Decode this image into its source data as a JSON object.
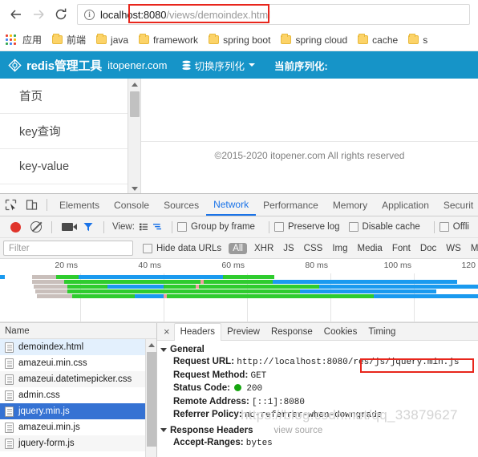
{
  "browser": {
    "back_icon": "arrow-left-icon",
    "forward_icon": "arrow-right-icon",
    "reload_icon": "reload-icon",
    "info_glyph": "i",
    "url_host": "localhost:8080",
    "url_path": "/views/demoindex.html",
    "apps_label": "应用",
    "bookmarks": [
      {
        "label": "前端"
      },
      {
        "label": "java"
      },
      {
        "label": "framework"
      },
      {
        "label": "spring boot"
      },
      {
        "label": "spring cloud"
      },
      {
        "label": "cache"
      },
      {
        "label": "s"
      }
    ]
  },
  "page": {
    "brand": "redis管理工具",
    "site": "itopener.com",
    "menu_serialize": "切换序列化",
    "current_serialize": "当前序列化:",
    "nav": [
      {
        "label": "首页"
      },
      {
        "label": "key查询"
      },
      {
        "label": "key-value"
      }
    ],
    "copyright": "©2015-2020 itopener.com All rights reserved",
    "header_color": "#1694c8"
  },
  "devtools": {
    "tabs": [
      {
        "label": "Elements",
        "active": false
      },
      {
        "label": "Console",
        "active": false
      },
      {
        "label": "Sources",
        "active": false
      },
      {
        "label": "Network",
        "active": true
      },
      {
        "label": "Performance",
        "active": false
      },
      {
        "label": "Memory",
        "active": false
      },
      {
        "label": "Application",
        "active": false
      },
      {
        "label": "Securit",
        "active": false
      }
    ],
    "toolbar": {
      "record_icon": "record-icon",
      "clear_icon": "clear-icon",
      "camera_icon": "camera-icon",
      "filter_icon": "funnel-icon",
      "view_label": "View:",
      "view_list_icon": "list-view-icon",
      "view_waterfall_icon": "waterfall-view-icon",
      "checkboxes": [
        {
          "label": "Group by frame",
          "checked": false
        },
        {
          "label": "Preserve log",
          "checked": false
        },
        {
          "label": "Disable cache",
          "checked": false
        },
        {
          "label": "Offli",
          "checked": false
        }
      ]
    },
    "filter_bar": {
      "filter_placeholder": "Filter",
      "filter_value": "",
      "hide_data_urls_label": "Hide data URLs",
      "types": [
        "All",
        "XHR",
        "JS",
        "CSS",
        "Img",
        "Media",
        "Font",
        "Doc",
        "WS",
        "Manife"
      ],
      "selected_type": "All"
    },
    "overview": {
      "ticks": [
        "20 ms",
        "40 ms",
        "60 ms",
        "80 ms",
        "100 ms",
        "120"
      ]
    },
    "requests": {
      "column_header": "Name",
      "rows": [
        {
          "name": "demoindex.html",
          "state": "current"
        },
        {
          "name": "amazeui.min.css",
          "state": "normal"
        },
        {
          "name": "amazeui.datetimepicker.css",
          "state": "alt"
        },
        {
          "name": "admin.css",
          "state": "normal"
        },
        {
          "name": "jquery.min.js",
          "state": "selected"
        },
        {
          "name": "amazeui.min.js",
          "state": "normal"
        },
        {
          "name": "jquery-form.js",
          "state": "alt"
        }
      ]
    },
    "detail": {
      "close_label": "×",
      "tabs": [
        {
          "label": "Headers",
          "active": true
        },
        {
          "label": "Preview",
          "active": false
        },
        {
          "label": "Response",
          "active": false
        },
        {
          "label": "Cookies",
          "active": false
        },
        {
          "label": "Timing",
          "active": false
        }
      ],
      "general_title": "General",
      "request_url_key": "Request URL:",
      "request_url_host": "http://localhost:8080",
      "request_url_path": "/res/js/jquery.min.js",
      "request_method_key": "Request Method:",
      "request_method_value": "GET",
      "status_code_key": "Status Code:",
      "status_code_value": "200",
      "remote_address_key": "Remote Address:",
      "remote_address_value": "[::1]:8080",
      "referrer_policy_key": "Referrer Policy:",
      "referrer_policy_value": "no-referrer-when-downgrade",
      "response_headers_title": "Response Headers",
      "view_source_label": "view source",
      "accept_ranges_key": "Accept-Ranges:",
      "accept_ranges_value": "bytes"
    }
  },
  "watermark": "https://blog.csdn.net/qq_33879627",
  "annotation_color": "#e8261c"
}
